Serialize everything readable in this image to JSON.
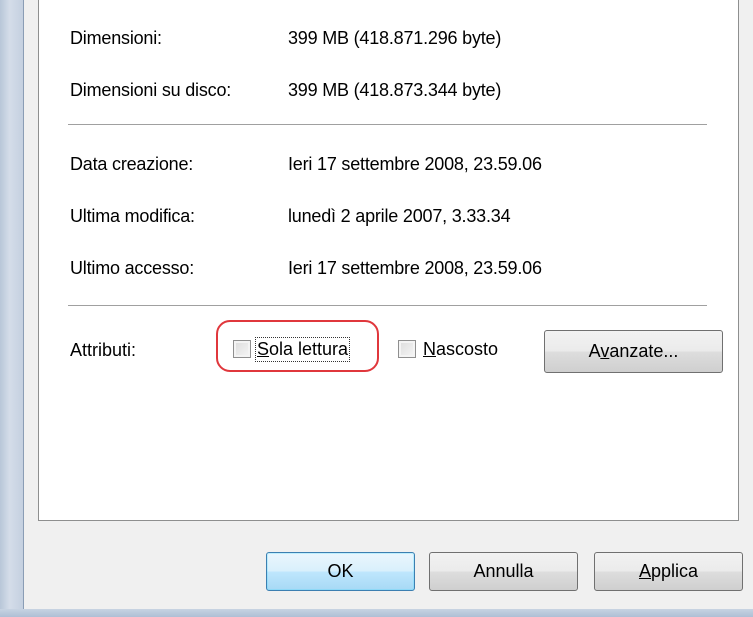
{
  "details": [
    {
      "label": "Dimensioni:",
      "value": "399 MB (418.871.296 byte)"
    },
    {
      "label": "Dimensioni su disco:",
      "value": "399 MB (418.873.344 byte)"
    },
    {
      "label": "Data creazione:",
      "value": "Ieri 17 settembre 2008, 23.59.06"
    },
    {
      "label": "Ultima modifica:",
      "value": "lunedì 2 aprile 2007, 3.33.34"
    },
    {
      "label": "Ultimo accesso:",
      "value": "Ieri 17 settembre 2008, 23.59.06"
    }
  ],
  "attributes": {
    "label": "Attributi:",
    "readonly": {
      "accel": "S",
      "rest": "ola lettura",
      "checked": false
    },
    "hidden": {
      "accel": "N",
      "rest": "ascosto",
      "checked": false
    },
    "advanced_button": {
      "pre": "A",
      "accel": "v",
      "rest": "anzate..."
    }
  },
  "buttons": {
    "ok": "OK",
    "cancel": "Annulla",
    "apply": {
      "accel": "A",
      "rest": "pplica"
    }
  },
  "colors": {
    "highlight_circle": "#e0373c",
    "default_button_border": "#3c7fb1"
  }
}
